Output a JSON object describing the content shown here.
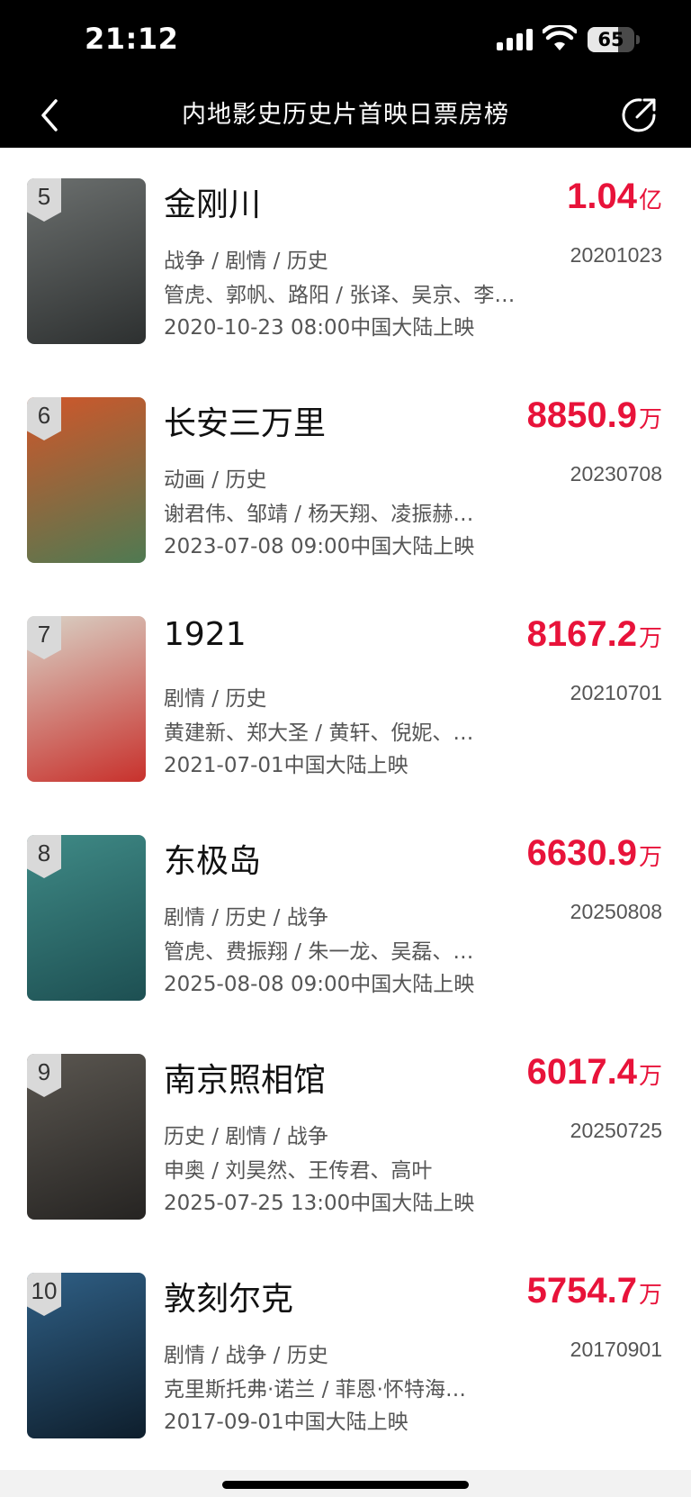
{
  "status": {
    "time": "21:12",
    "battery": "65",
    "battery_level": 0.65
  },
  "nav": {
    "title": "内地影史历史片首映日票房榜"
  },
  "movies": [
    {
      "rank": "5",
      "title": "金刚川",
      "amount": "1.04",
      "unit": "亿",
      "genres": "战争 / 剧情 / 历史",
      "date_code": "20201023",
      "cast": "管虎、郭帆、路阳 / 张译、吴京、李…",
      "release": "2020-10-23 08:00中国大陆上映",
      "poster_colors": [
        "#6b6f6e",
        "#2d3030"
      ]
    },
    {
      "rank": "6",
      "title": "长安三万里",
      "amount": "8850.9",
      "unit": "万",
      "genres": "动画 / 历史",
      "date_code": "20230708",
      "cast": "谢君伟、邹靖 / 杨天翔、凌振赫…",
      "release": "2023-07-08 09:00中国大陆上映",
      "poster_colors": [
        "#d0562a",
        "#4f7a52"
      ]
    },
    {
      "rank": "7",
      "title": "1921",
      "amount": "8167.2",
      "unit": "万",
      "genres": "剧情 / 历史",
      "date_code": "20210701",
      "cast": "黄建新、郑大圣 / 黄轩、倪妮、…",
      "release": "2021-07-01中国大陆上映",
      "poster_colors": [
        "#d9d2c6",
        "#c8312c"
      ]
    },
    {
      "rank": "8",
      "title": "东极岛",
      "amount": "6630.9",
      "unit": "万",
      "genres": "剧情 / 历史 / 战争",
      "date_code": "20250808",
      "cast": "管虎、费振翔 / 朱一龙、吴磊、…",
      "release": "2025-08-08 09:00中国大陆上映",
      "poster_colors": [
        "#3f8a86",
        "#1d4f52"
      ]
    },
    {
      "rank": "9",
      "title": "南京照相馆",
      "amount": "6017.4",
      "unit": "万",
      "genres": "历史 / 剧情 / 战争",
      "date_code": "20250725",
      "cast": "申奥 / 刘昊然、王传君、高叶",
      "release": "2025-07-25 13:00中国大陆上映",
      "poster_colors": [
        "#5a5650",
        "#262422"
      ]
    },
    {
      "rank": "10",
      "title": "敦刻尔克",
      "amount": "5754.7",
      "unit": "万",
      "genres": "剧情 / 战争 / 历史",
      "date_code": "20170901",
      "cast": "克里斯托弗·诺兰 / 菲恩·怀特海…",
      "release": "2017-09-01中国大陆上映",
      "poster_colors": [
        "#2f5f85",
        "#0e1e2c"
      ]
    }
  ]
}
